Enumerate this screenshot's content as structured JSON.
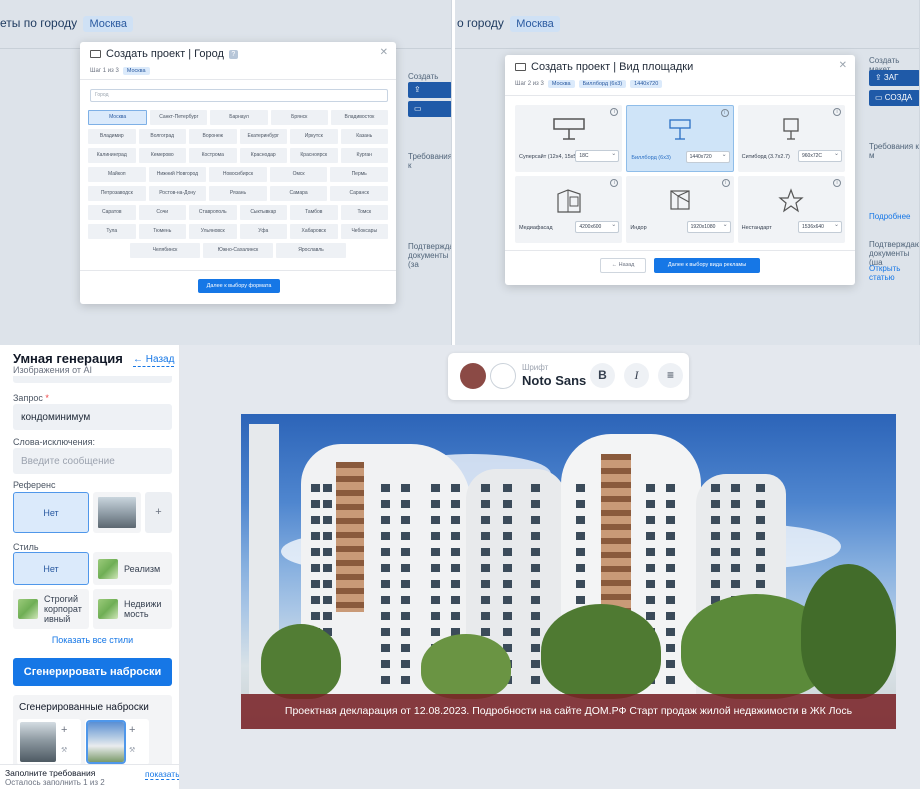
{
  "panel1": {
    "bg_title": "еты по городу",
    "bg_city": "Москва",
    "bg_side": [
      "Создать макет",
      "Требования к",
      "Подтверждаю документы (за"
    ],
    "modal": {
      "title": "Создать проект | Город",
      "step": "Шаг 1 из 3",
      "tag": "Москва",
      "search_placeholder": "Город",
      "cities": [
        [
          "Москва",
          "Санкт-Петербург",
          "Барнаул",
          "Брянск",
          "Владивосток"
        ],
        [
          "Владимир",
          "Волгоград",
          "Воронеж",
          "Екатеринбург",
          "Иркутск",
          "Казань"
        ],
        [
          "Калининград",
          "Кемерово",
          "Кострома",
          "Краснодар",
          "Красноярск",
          "Курган"
        ],
        [
          "Майкоп",
          "Нижний Новгород",
          "Новосибирск",
          "Омск",
          "Пермь"
        ],
        [
          "Петрозаводск",
          "Ростов-на-Дону",
          "Рязань",
          "Самара",
          "Саранск"
        ],
        [
          "Саратов",
          "Сочи",
          "Ставрополь",
          "Сыктывкар",
          "Тамбов",
          "Томск"
        ],
        [
          "Тула",
          "Тюмень",
          "Ульяновск",
          "Уфа",
          "Хабаровск",
          "Чебоксары"
        ],
        [
          "Челябинск",
          "Южно-Сахалинск",
          "Ярославль"
        ]
      ],
      "next_button": "Далее к выбору формата"
    }
  },
  "panel2": {
    "bg_title": "о городу",
    "bg_city": "Москва",
    "bg_side": [
      "Создать макет",
      "Требования к м",
      "Подтверждающ документы (ша",
      "Подробнее",
      "Открыть статью"
    ],
    "modal": {
      "title": "Создать проект | Вид площадки",
      "step": "Шаг 2 из 3",
      "tags": [
        "Москва",
        "Биллборд (6x3)",
        "1440x720"
      ],
      "venues": [
        {
          "label": "Суперсайт (12x4, 15x5)",
          "size": "18C",
          "selected": false
        },
        {
          "label": "Биллборд (6x3)",
          "size": "1440x720",
          "selected": true
        },
        {
          "label": "Ситиборд (3.7x2.7)",
          "size": "960x72C",
          "selected": false
        },
        {
          "label": "Медиафасад",
          "size": "4200x600",
          "selected": false
        },
        {
          "label": "Индор",
          "size": "1920x1080",
          "selected": false
        },
        {
          "label": "Нестандарт",
          "size": "1536x640",
          "selected": false
        }
      ],
      "back_button": "← Назад",
      "next_button": "Далее к выбору вида рекламы"
    }
  },
  "sidebar": {
    "title": "Умная генерация",
    "subtitle": "Изображения от AI",
    "back": "← Назад",
    "query_label": "Запрос",
    "query_value": "кондоминимум",
    "exclusions_label": "Слова-исключения:",
    "exclusions_placeholder": "Введите сообщение",
    "reference_label": "Референс",
    "reference_none": "Нет",
    "style_label": "Стиль",
    "styles": [
      "Нет",
      "Реализм",
      "Строгий корпорат ивный",
      "Недвижи мость"
    ],
    "show_all": "Показать все стили",
    "generate_button": "Сгенерировать наброски",
    "generated_title": "Сгенерированные наброски",
    "footer_title": "Заполните требования",
    "footer_sub": "Осталось заполнить 1 из 2",
    "footer_link": "показать"
  },
  "editor": {
    "colors": {
      "primary": "#8b4a45",
      "secondary": "#ffffff",
      "accent": "#1677e6",
      "caption_bg": "#781e23"
    },
    "font_caption": "Шрифт",
    "font_name": "Noto Sans",
    "bold_label": "B",
    "italic_label": "I",
    "align_label": "≡",
    "caption": "Проектная декларация от 12.08.2023. Подробности на сайте ДОМ.РФ Старт продаж жилой недвжимости в ЖК Лось"
  }
}
